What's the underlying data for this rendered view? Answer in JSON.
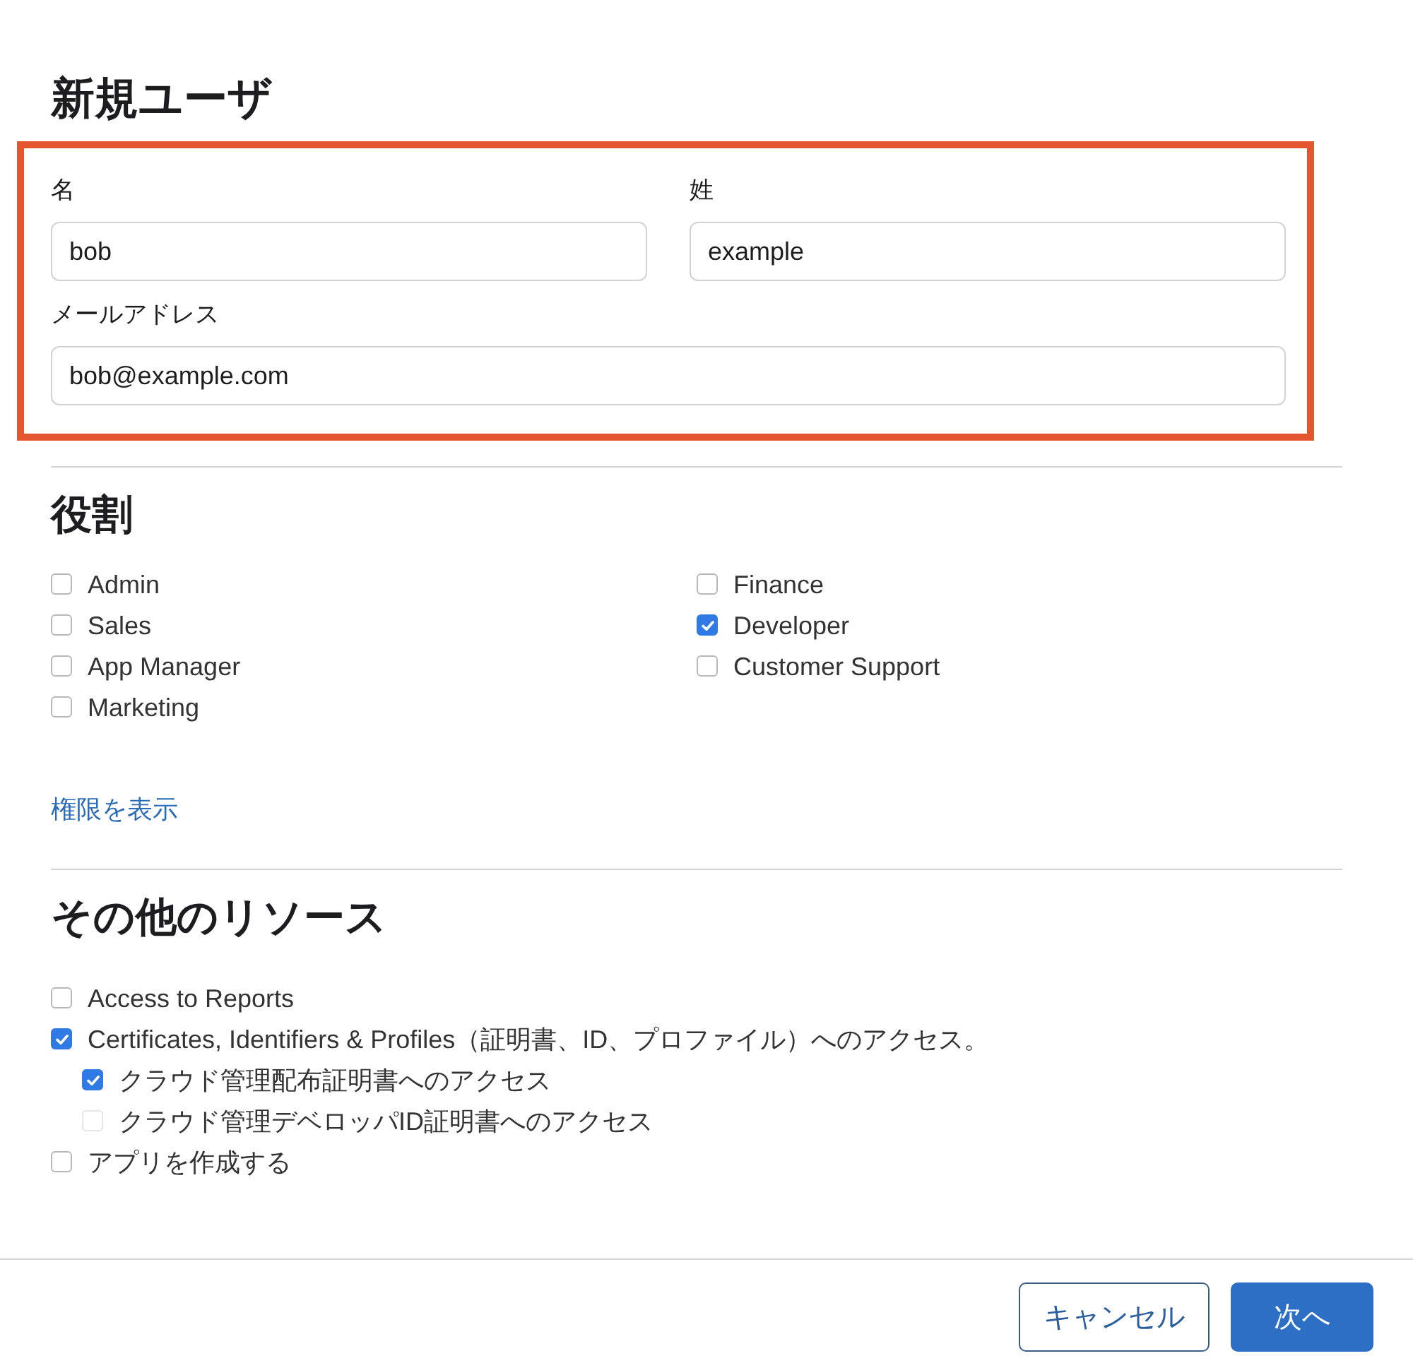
{
  "title": "新規ユーザ",
  "fields": [
    {
      "label": "名",
      "value": "bob",
      "wide": false
    },
    {
      "label": "姓",
      "value": "example",
      "wide": false
    },
    {
      "label": "メールアドレス",
      "value": "bob@example.com",
      "wide": true
    }
  ],
  "roles": {
    "title": "役割",
    "columns": [
      [
        {
          "label": "Admin",
          "checked": false
        },
        {
          "label": "Sales",
          "checked": false
        },
        {
          "label": "App Manager",
          "checked": false
        },
        {
          "label": "Marketing",
          "checked": false
        }
      ],
      [
        {
          "label": "Finance",
          "checked": false
        },
        {
          "label": "Developer",
          "checked": true
        },
        {
          "label": "Customer Support",
          "checked": false
        }
      ]
    ],
    "link": "権限を表示"
  },
  "resources": {
    "title": "その他のリソース",
    "items": [
      {
        "label": "Access to Reports",
        "checked": false,
        "disabled": false
      },
      {
        "label": "Certificates, Identifiers & Profiles（証明書、ID、プロファイル）へのアクセス。",
        "checked": true,
        "disabled": false,
        "children": [
          {
            "label": "クラウド管理配布証明書へのアクセス",
            "checked": true,
            "disabled": false
          },
          {
            "label": "クラウド管理デベロッパID証明書へのアクセス",
            "checked": false,
            "disabled": true
          }
        ]
      },
      {
        "label": "アプリを作成する",
        "checked": false,
        "disabled": false
      }
    ]
  },
  "buttons": [
    {
      "label": "キャンセル",
      "kind": "secondary"
    },
    {
      "label": "次へ",
      "kind": "primary"
    }
  ]
}
